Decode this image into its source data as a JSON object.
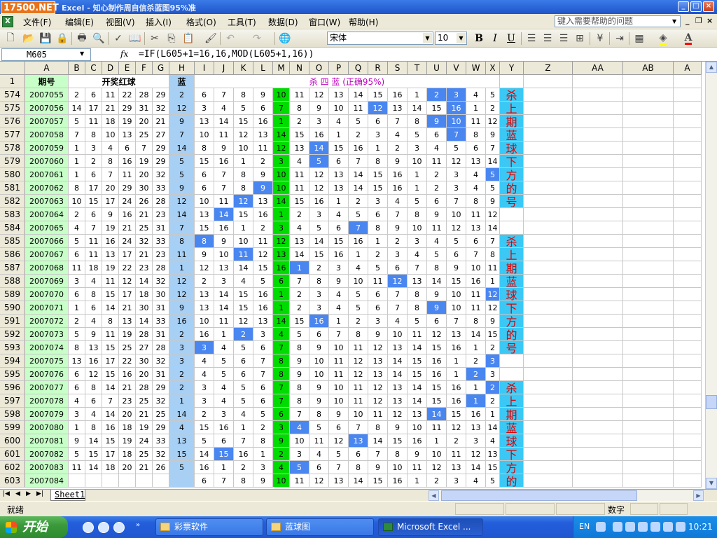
{
  "window": {
    "logo": "17500.NET",
    "title": "Excel - 知心制作周自信杀蓝图95%准",
    "min": "_",
    "max": "□",
    "close": "×"
  },
  "menu": {
    "items": [
      "文件(F)",
      "编辑(E)",
      "视图(V)",
      "插入(I)",
      "格式(O)",
      "工具(T)",
      "数据(D)",
      "窗口(W)",
      "帮助(H)"
    ],
    "help_placeholder": "键入需要帮助的问题"
  },
  "toolbar": {
    "font": "宋体",
    "size": "10",
    "bold": "B",
    "italic": "I",
    "underline": "U"
  },
  "formula_bar": {
    "namebox": "M605",
    "fx": "fx",
    "formula": "=IF(L605+1=16,16,MOD(L605+1,16))"
  },
  "grid": {
    "columns": [
      "A",
      "B",
      "C",
      "D",
      "E",
      "F",
      "G",
      "H",
      "I",
      "J",
      "K",
      "L",
      "M",
      "N",
      "O",
      "P",
      "Q",
      "R",
      "S",
      "T",
      "U",
      "V",
      "W",
      "X",
      "Y",
      "Z",
      "AA",
      "AB",
      "A"
    ],
    "header_row": {
      "row_num": "1",
      "col_a": "期号",
      "red": "开奖红球",
      "blue": "蓝",
      "kill": "杀 四 蓝 (正确95%)"
    },
    "rows": [
      {
        "n": "574",
        "id": "2007055",
        "red": [
          "2",
          "6",
          "11",
          "22",
          "28",
          "29"
        ],
        "blue": "2",
        "kill": [
          "6",
          "7",
          "8",
          "9",
          "10",
          "11",
          "12",
          "13",
          "14",
          "15",
          "16",
          "1",
          "2",
          "3",
          "4",
          "5"
        ],
        "hits": [
          12,
          13
        ]
      },
      {
        "n": "575",
        "id": "2007056",
        "red": [
          "14",
          "17",
          "21",
          "29",
          "31",
          "32"
        ],
        "blue": "12",
        "kill": [
          "3",
          "4",
          "5",
          "6",
          "7",
          "8",
          "9",
          "10",
          "11",
          "12",
          "13",
          "14",
          "15",
          "16",
          "1",
          "2"
        ],
        "hits": [
          9,
          13
        ]
      },
      {
        "n": "576",
        "id": "2007057",
        "red": [
          "5",
          "11",
          "18",
          "19",
          "20",
          "21"
        ],
        "blue": "9",
        "kill": [
          "13",
          "14",
          "15",
          "16",
          "1",
          "2",
          "3",
          "4",
          "5",
          "6",
          "7",
          "8",
          "9",
          "10",
          "11",
          "12"
        ],
        "hits": [
          12,
          13
        ]
      },
      {
        "n": "577",
        "id": "2007058",
        "red": [
          "7",
          "8",
          "10",
          "13",
          "25",
          "27"
        ],
        "blue": "7",
        "kill": [
          "10",
          "11",
          "12",
          "13",
          "14",
          "15",
          "16",
          "1",
          "2",
          "3",
          "4",
          "5",
          "6",
          "7",
          "8",
          "9"
        ],
        "hits": [
          13
        ]
      },
      {
        "n": "578",
        "id": "2007059",
        "red": [
          "1",
          "3",
          "4",
          "6",
          "7",
          "29"
        ],
        "blue": "14",
        "kill": [
          "8",
          "9",
          "10",
          "11",
          "12",
          "13",
          "14",
          "15",
          "16",
          "1",
          "2",
          "3",
          "4",
          "5",
          "6",
          "7"
        ],
        "hits": [
          6
        ]
      },
      {
        "n": "579",
        "id": "2007060",
        "red": [
          "1",
          "2",
          "8",
          "16",
          "19",
          "29"
        ],
        "blue": "5",
        "kill": [
          "15",
          "16",
          "1",
          "2",
          "3",
          "4",
          "5",
          "6",
          "7",
          "8",
          "9",
          "10",
          "11",
          "12",
          "13",
          "14"
        ],
        "hits": [
          6
        ]
      },
      {
        "n": "580",
        "id": "2007061",
        "red": [
          "1",
          "6",
          "7",
          "11",
          "20",
          "32"
        ],
        "blue": "5",
        "kill": [
          "6",
          "7",
          "8",
          "9",
          "10",
          "11",
          "12",
          "13",
          "14",
          "15",
          "16",
          "1",
          "2",
          "3",
          "4",
          "5"
        ],
        "hits": [
          15
        ]
      },
      {
        "n": "581",
        "id": "2007062",
        "red": [
          "8",
          "17",
          "20",
          "29",
          "30",
          "33"
        ],
        "blue": "9",
        "kill": [
          "6",
          "7",
          "8",
          "9",
          "10",
          "11",
          "12",
          "13",
          "14",
          "15",
          "16",
          "1",
          "2",
          "3",
          "4",
          "5"
        ],
        "hits": [
          3
        ]
      },
      {
        "n": "582",
        "id": "2007063",
        "red": [
          "10",
          "15",
          "17",
          "24",
          "26",
          "28"
        ],
        "blue": "12",
        "kill": [
          "10",
          "11",
          "12",
          "13",
          "14",
          "15",
          "16",
          "1",
          "2",
          "3",
          "4",
          "5",
          "6",
          "7",
          "8",
          "9"
        ],
        "hits": [
          2
        ]
      },
      {
        "n": "583",
        "id": "2007064",
        "red": [
          "2",
          "6",
          "9",
          "16",
          "21",
          "23"
        ],
        "blue": "14",
        "kill": [
          "13",
          "14",
          "15",
          "16",
          "1",
          "2",
          "3",
          "4",
          "5",
          "6",
          "7",
          "8",
          "9",
          "10",
          "11",
          "12"
        ],
        "hits": [
          1
        ]
      },
      {
        "n": "584",
        "id": "2007065",
        "red": [
          "4",
          "7",
          "19",
          "21",
          "25",
          "31"
        ],
        "blue": "7",
        "kill": [
          "15",
          "16",
          "1",
          "2",
          "3",
          "4",
          "5",
          "6",
          "7",
          "8",
          "9",
          "10",
          "11",
          "12",
          "13",
          "14"
        ],
        "hits": [
          8
        ]
      },
      {
        "n": "585",
        "id": "2007066",
        "red": [
          "5",
          "11",
          "16",
          "24",
          "32",
          "33"
        ],
        "blue": "8",
        "kill": [
          "8",
          "9",
          "10",
          "11",
          "12",
          "13",
          "14",
          "15",
          "16",
          "1",
          "2",
          "3",
          "4",
          "5",
          "6",
          "7"
        ],
        "hits": [
          0
        ]
      },
      {
        "n": "586",
        "id": "2007067",
        "red": [
          "6",
          "11",
          "13",
          "17",
          "21",
          "23"
        ],
        "blue": "11",
        "kill": [
          "9",
          "10",
          "11",
          "12",
          "13",
          "14",
          "15",
          "16",
          "1",
          "2",
          "3",
          "4",
          "5",
          "6",
          "7",
          "8"
        ],
        "hits": [
          2
        ]
      },
      {
        "n": "587",
        "id": "2007068",
        "red": [
          "11",
          "18",
          "19",
          "22",
          "23",
          "28"
        ],
        "blue": "1",
        "kill": [
          "12",
          "13",
          "14",
          "15",
          "16",
          "1",
          "2",
          "3",
          "4",
          "5",
          "6",
          "7",
          "8",
          "9",
          "10",
          "11"
        ],
        "hits": [
          5
        ]
      },
      {
        "n": "588",
        "id": "2007069",
        "red": [
          "3",
          "4",
          "11",
          "12",
          "14",
          "32"
        ],
        "blue": "12",
        "kill": [
          "2",
          "3",
          "4",
          "5",
          "6",
          "7",
          "8",
          "9",
          "10",
          "11",
          "12",
          "13",
          "14",
          "15",
          "16",
          "1"
        ],
        "hits": [
          10
        ]
      },
      {
        "n": "589",
        "id": "2007070",
        "red": [
          "6",
          "8",
          "15",
          "17",
          "18",
          "30"
        ],
        "blue": "12",
        "kill": [
          "13",
          "14",
          "15",
          "16",
          "1",
          "2",
          "3",
          "4",
          "5",
          "6",
          "7",
          "8",
          "9",
          "10",
          "11",
          "12"
        ],
        "hits": [
          15
        ]
      },
      {
        "n": "590",
        "id": "2007071",
        "red": [
          "1",
          "6",
          "14",
          "21",
          "30",
          "31"
        ],
        "blue": "9",
        "kill": [
          "13",
          "14",
          "15",
          "16",
          "1",
          "2",
          "3",
          "4",
          "5",
          "6",
          "7",
          "8",
          "9",
          "10",
          "11",
          "12"
        ],
        "hits": [
          12
        ]
      },
      {
        "n": "591",
        "id": "2007072",
        "red": [
          "2",
          "4",
          "8",
          "13",
          "14",
          "33"
        ],
        "blue": "16",
        "kill": [
          "10",
          "11",
          "12",
          "13",
          "14",
          "15",
          "16",
          "1",
          "2",
          "3",
          "4",
          "5",
          "6",
          "7",
          "8",
          "9"
        ],
        "hits": [
          6
        ]
      },
      {
        "n": "592",
        "id": "2007073",
        "red": [
          "5",
          "9",
          "11",
          "19",
          "28",
          "31"
        ],
        "blue": "2",
        "kill": [
          "16",
          "1",
          "2",
          "3",
          "4",
          "5",
          "6",
          "7",
          "8",
          "9",
          "10",
          "11",
          "12",
          "13",
          "14",
          "15"
        ],
        "hits": [
          2
        ]
      },
      {
        "n": "593",
        "id": "2007074",
        "red": [
          "8",
          "13",
          "15",
          "25",
          "27",
          "28"
        ],
        "blue": "3",
        "kill": [
          "3",
          "4",
          "5",
          "6",
          "7",
          "8",
          "9",
          "10",
          "11",
          "12",
          "13",
          "14",
          "15",
          "16",
          "1",
          "2"
        ],
        "hits": [
          0
        ]
      },
      {
        "n": "594",
        "id": "2007075",
        "red": [
          "13",
          "16",
          "17",
          "22",
          "30",
          "32"
        ],
        "blue": "3",
        "kill": [
          "4",
          "5",
          "6",
          "7",
          "8",
          "9",
          "10",
          "11",
          "12",
          "13",
          "14",
          "15",
          "16",
          "1",
          "2",
          "3"
        ],
        "hits": [
          15
        ]
      },
      {
        "n": "595",
        "id": "2007076",
        "red": [
          "6",
          "12",
          "15",
          "16",
          "20",
          "31"
        ],
        "blue": "2",
        "kill": [
          "4",
          "5",
          "6",
          "7",
          "8",
          "9",
          "10",
          "11",
          "12",
          "13",
          "14",
          "15",
          "16",
          "1",
          "2",
          "3"
        ],
        "hits": [
          14
        ]
      },
      {
        "n": "596",
        "id": "2007077",
        "red": [
          "6",
          "8",
          "14",
          "21",
          "28",
          "29"
        ],
        "blue": "2",
        "kill": [
          "3",
          "4",
          "5",
          "6",
          "7",
          "8",
          "9",
          "10",
          "11",
          "12",
          "13",
          "14",
          "15",
          "16",
          "1",
          "2"
        ],
        "hits": [
          15
        ]
      },
      {
        "n": "597",
        "id": "2007078",
        "red": [
          "4",
          "6",
          "7",
          "23",
          "25",
          "32"
        ],
        "blue": "1",
        "kill": [
          "3",
          "4",
          "5",
          "6",
          "7",
          "8",
          "9",
          "10",
          "11",
          "12",
          "13",
          "14",
          "15",
          "16",
          "1",
          "2"
        ],
        "hits": [
          14
        ]
      },
      {
        "n": "598",
        "id": "2007079",
        "red": [
          "3",
          "4",
          "14",
          "20",
          "21",
          "25"
        ],
        "blue": "14",
        "kill": [
          "2",
          "3",
          "4",
          "5",
          "6",
          "7",
          "8",
          "9",
          "10",
          "11",
          "12",
          "13",
          "14",
          "15",
          "16",
          "1"
        ],
        "hits": [
          12
        ]
      },
      {
        "n": "599",
        "id": "2007080",
        "red": [
          "1",
          "8",
          "16",
          "18",
          "19",
          "29"
        ],
        "blue": "4",
        "kill": [
          "15",
          "16",
          "1",
          "2",
          "3",
          "4",
          "5",
          "6",
          "7",
          "8",
          "9",
          "10",
          "11",
          "12",
          "13",
          "14"
        ],
        "hits": [
          5
        ]
      },
      {
        "n": "600",
        "id": "2007081",
        "red": [
          "9",
          "14",
          "15",
          "19",
          "24",
          "33"
        ],
        "blue": "13",
        "kill": [
          "5",
          "6",
          "7",
          "8",
          "9",
          "10",
          "11",
          "12",
          "13",
          "14",
          "15",
          "16",
          "1",
          "2",
          "3",
          "4"
        ],
        "hits": [
          8
        ]
      },
      {
        "n": "601",
        "id": "2007082",
        "red": [
          "5",
          "15",
          "17",
          "18",
          "25",
          "32"
        ],
        "blue": "15",
        "kill": [
          "14",
          "15",
          "16",
          "1",
          "2",
          "3",
          "4",
          "5",
          "6",
          "7",
          "8",
          "9",
          "10",
          "11",
          "12",
          "13"
        ],
        "hits": [
          1
        ]
      },
      {
        "n": "602",
        "id": "2007083",
        "red": [
          "11",
          "14",
          "18",
          "20",
          "21",
          "26"
        ],
        "blue": "5",
        "kill": [
          "16",
          "1",
          "2",
          "3",
          "4",
          "5",
          "6",
          "7",
          "8",
          "9",
          "10",
          "11",
          "12",
          "13",
          "14",
          "15"
        ],
        "hits": [
          5
        ]
      },
      {
        "n": "603",
        "id": "2007084",
        "red": [
          "",
          "",
          "",
          "",
          "",
          ""
        ],
        "blue": "",
        "kill": [
          "6",
          "7",
          "8",
          "9",
          "10",
          "11",
          "12",
          "13",
          "14",
          "15",
          "16",
          "1",
          "2",
          "3",
          "4",
          "5"
        ],
        "hits": []
      }
    ],
    "side_text": [
      {
        "start": 0,
        "chars": [
          "杀",
          "上",
          "期",
          "蓝",
          "球",
          "下",
          "方",
          "的",
          "号"
        ]
      },
      {
        "start": 11,
        "chars": [
          "杀",
          "上",
          "期",
          "蓝",
          "球",
          "下",
          "方",
          "的",
          "号"
        ]
      },
      {
        "start": 22,
        "chars": [
          "杀",
          "上",
          "期",
          "蓝",
          "球",
          "下",
          "方",
          "的"
        ]
      }
    ]
  },
  "sheet": {
    "tab": "Sheet1",
    "nav": [
      "|◀",
      "◀",
      "▶",
      "▶|"
    ]
  },
  "status": {
    "ready": "就绪",
    "mode": "数字"
  },
  "taskbar": {
    "start": "开始",
    "tasks": [
      "彩票软件",
      "蓝球图",
      "Microsoft Excel ..."
    ],
    "lang": "EN",
    "clock": "10:21"
  }
}
